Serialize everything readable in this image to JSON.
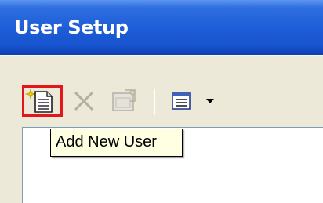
{
  "window": {
    "title": "User Setup"
  },
  "toolbar": {
    "add_user_icon": "new-user-document-icon",
    "delete_icon": "delete-x-icon",
    "properties_icon": "properties-icon",
    "view_icon": "list-view-icon",
    "view_dropdown_icon": "dropdown-arrow-icon"
  },
  "tooltip": {
    "text": "Add New User"
  },
  "colors": {
    "titlebar": "#1e5ed7",
    "toolbar": "#ece9d8",
    "highlight_border": "#e2161b",
    "tooltip_background": "#ffffe1"
  }
}
